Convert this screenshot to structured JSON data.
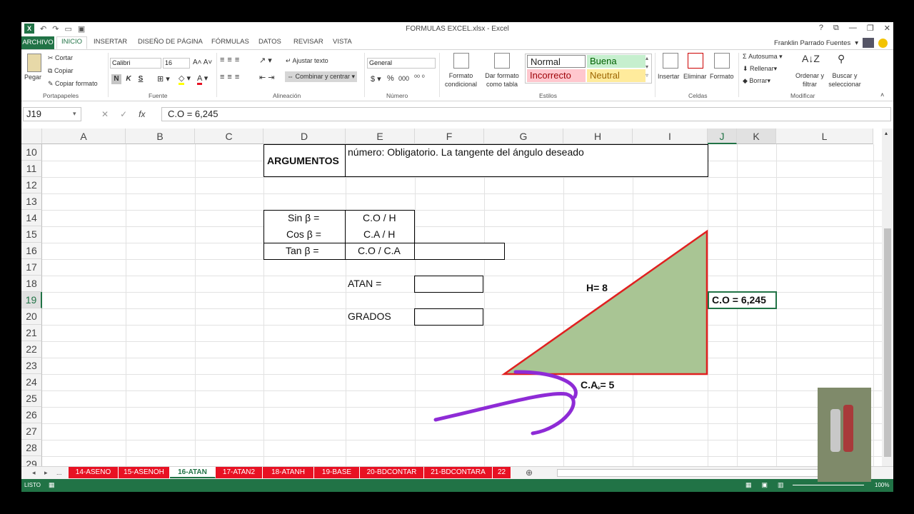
{
  "window": {
    "title": "FORMULAS EXCEL.xlsx - Excel",
    "controls": [
      "?",
      "⧉",
      "—",
      "❐",
      "✕"
    ]
  },
  "tabs": [
    "ARCHIVO",
    "INICIO",
    "INSERTAR",
    "DISEÑO DE PÁGINA",
    "FÓRMULAS",
    "DATOS",
    "REVISAR",
    "VISTA"
  ],
  "user": {
    "name": "Franklin Parrado Fuentes"
  },
  "ribbon": {
    "clipboard": {
      "paste": "Pegar",
      "cut": "Cortar",
      "copy": "Copiar",
      "format_painter": "Copiar formato",
      "label": "Portapapeles"
    },
    "font": {
      "name": "Calibri",
      "size": "16",
      "label": "Fuente",
      "bold": "N",
      "italic": "K",
      "underline": "S"
    },
    "alignment": {
      "wrap": "Ajustar texto",
      "merge": "Combinar y centrar",
      "label": "Alineación"
    },
    "number": {
      "format": "General",
      "currency": "$",
      "percent": "%",
      "thousands": "000",
      "label": "Número"
    },
    "styles": {
      "conditional": "Formato condicional",
      "as_table": "Dar formato como tabla",
      "normal": "Normal",
      "good": "Buena",
      "bad": "Incorrecto",
      "neutral": "Neutral",
      "label": "Estilos"
    },
    "cells": {
      "insert": "Insertar",
      "delete": "Eliminar",
      "format": "Formato",
      "label": "Celdas"
    },
    "editing": {
      "autosum": "Autosuma",
      "fill": "Rellenar",
      "clear": "Borrar",
      "sort": "Ordenar y filtrar",
      "find": "Buscar y seleccionar",
      "label": "Modificar"
    }
  },
  "formula_bar": {
    "name_box": "J19",
    "formula": "C.O = 6,245",
    "fx": "fx"
  },
  "columns": [
    "A",
    "B",
    "C",
    "D",
    "E",
    "F",
    "G",
    "H",
    "I",
    "J",
    "K",
    "L"
  ],
  "rows": [
    "10",
    "11",
    "12",
    "13",
    "14",
    "15",
    "16",
    "17",
    "18",
    "19",
    "20",
    "21",
    "22",
    "23",
    "24",
    "25",
    "26",
    "27",
    "28",
    "29"
  ],
  "cells": {
    "argumentos": "ARGUMENTOS",
    "description": "número: Obligatorio. La tangente del ángulo deseado",
    "sin_label": "Sin β =",
    "sin_value": "C.O / H",
    "cos_label": "Cos β =",
    "cos_value": "C.A / H",
    "tan_label": "Tan β =",
    "tan_value": "C.O / C.A",
    "atan_label": "ATAN =",
    "grados_label": "GRADOS",
    "hyp": "H= 8",
    "opp": "C.O = 6,245",
    "adj": "C.A = 5"
  },
  "sheets": [
    "14-ASENO",
    "15-ASENOH",
    "16-ATAN",
    "17-ATAN2",
    "18-ATANH",
    "19-BASE",
    "20-BDCONTAR",
    "21-BDCONTARA",
    "22"
  ],
  "sheet_nav": [
    "◂",
    "▸",
    "..."
  ],
  "status": {
    "ready": "LISTO",
    "zoom": "100%"
  },
  "colors": {
    "excel_green": "#217346",
    "sheet_tab_red": "#e81123",
    "triangle_fill": "#a9c594",
    "triangle_stroke": "#e02020",
    "arrow": "#8e2bd6"
  }
}
